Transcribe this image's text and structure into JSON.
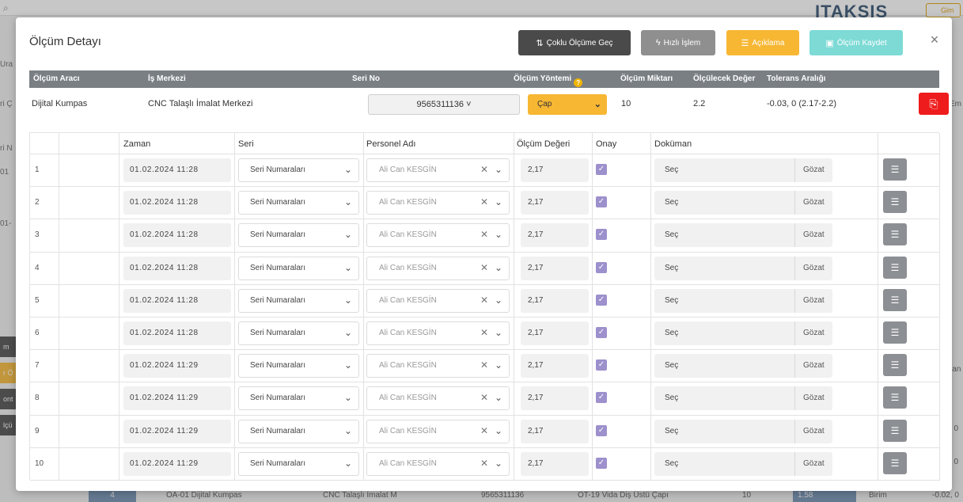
{
  "background": {
    "logo": "ITAKSIS",
    "logo_button": "Gim",
    "left_fragments": [
      "Ura",
      "ri Ç",
      "ri N",
      "01",
      "01-"
    ],
    "left_buttons": [
      {
        "label": "m",
        "color": "#4a4a4a"
      },
      {
        "label": "r Ö",
        "color": "#f7b733"
      },
      {
        "label": "ont",
        "color": "#4a4a4a"
      },
      {
        "label": "lçü",
        "color": "#4a4a4a"
      }
    ],
    "right_fragments": [
      "Em",
      "ran",
      ", 0",
      ", 0"
    ],
    "bottom_row": [
      "4",
      "OA-01 Dijital Kumpas",
      "CNC Talaşlı İmalat M",
      "9565311136",
      "OT-19 Vida Diş Üstü Çapı",
      "10",
      "1.58",
      "Birim",
      "-0.02, 0"
    ]
  },
  "modal": {
    "title": "Ölçüm Detayı",
    "close_label": "×",
    "buttons": {
      "coklu": "Çoklu Ölçüme Geç",
      "hizli": "Hızlı İşlem",
      "aciklama": "Açıklama",
      "kaydet": "Ölçüm Kaydet"
    },
    "header": {
      "olcum_araci": "Ölçüm Aracı",
      "is_merkezi": "İş Merkezi",
      "seri_no": "Seri No",
      "olcum_yontemi": "Ölçüm Yöntemi",
      "olcum_miktari": "Ölçüm Miktarı",
      "olculecek_deger": "Ölçülecek Değer",
      "tolerans_araligi": "Tolerans Aralığı"
    },
    "info": {
      "olcum_araci": "Dijital Kumpas",
      "is_merkezi": "CNC Talaşlı İmalat Merkezi",
      "seri_no": "9565311136 ˅",
      "olcum_yontemi": "Çap",
      "olcum_miktari": "10",
      "olculecek_deger": "2.2",
      "tolerans_araligi": "-0.03, 0 (2.17-2.2)"
    },
    "table": {
      "columns": [
        "Zaman",
        "Seri",
        "Personel Adı",
        "Ölçüm Değeri",
        "Onay",
        "Doküman"
      ],
      "rows": [
        {
          "no": "1",
          "zaman": "01.02.2024 11:28",
          "seri": "Seri Numaraları",
          "personel": "Ali Can KESGİN",
          "deger": "2,17",
          "dokuman": "Seç",
          "gozat": "Gözat"
        },
        {
          "no": "2",
          "zaman": "01.02.2024 11:28",
          "seri": "Seri Numaraları",
          "personel": "Ali Can KESGİN",
          "deger": "2,17",
          "dokuman": "Seç",
          "gozat": "Gözat"
        },
        {
          "no": "3",
          "zaman": "01.02.2024 11:28",
          "seri": "Seri Numaraları",
          "personel": "Ali Can KESGİN",
          "deger": "2,17",
          "dokuman": "Seç",
          "gozat": "Gözat"
        },
        {
          "no": "4",
          "zaman": "01.02.2024 11:28",
          "seri": "Seri Numaraları",
          "personel": "Ali Can KESGİN",
          "deger": "2,17",
          "dokuman": "Seç",
          "gozat": "Gözat"
        },
        {
          "no": "5",
          "zaman": "01.02.2024 11:28",
          "seri": "Seri Numaraları",
          "personel": "Ali Can KESGİN",
          "deger": "2,17",
          "dokuman": "Seç",
          "gozat": "Gözat"
        },
        {
          "no": "6",
          "zaman": "01.02.2024 11:28",
          "seri": "Seri Numaraları",
          "personel": "Ali Can KESGİN",
          "deger": "2,17",
          "dokuman": "Seç",
          "gozat": "Gözat"
        },
        {
          "no": "7",
          "zaman": "01.02.2024 11:29",
          "seri": "Seri Numaraları",
          "personel": "Ali Can KESGİN",
          "deger": "2,17",
          "dokuman": "Seç",
          "gozat": "Gözat"
        },
        {
          "no": "8",
          "zaman": "01.02.2024 11:29",
          "seri": "Seri Numaraları",
          "personel": "Ali Can KESGİN",
          "deger": "2,17",
          "dokuman": "Seç",
          "gozat": "Gözat"
        },
        {
          "no": "9",
          "zaman": "01.02.2024 11:29",
          "seri": "Seri Numaraları",
          "personel": "Ali Can KESGİN",
          "deger": "2,17",
          "dokuman": "Seç",
          "gozat": "Gözat"
        },
        {
          "no": "10",
          "zaman": "01.02.2024 11:29",
          "seri": "Seri Numaraları",
          "personel": "Ali Can KESGİN",
          "deger": "2,17",
          "dokuman": "Seç",
          "gozat": "Gözat"
        }
      ]
    }
  },
  "colors": {
    "header_bar": "#7a7f84",
    "accent_yellow": "#f7b733",
    "accent_teal": "#7ddad5",
    "dark_button": "#4a4a4a",
    "pdf_red": "#ee1c1c",
    "checkbox": "#9d90cc"
  },
  "icons": {
    "coklu": "split-arrows-icon",
    "hizli": "lightning-icon",
    "aciklama": "list-icon",
    "kaydet": "save-icon",
    "pdf": "pdf-icon",
    "row_action": "list-icon"
  }
}
